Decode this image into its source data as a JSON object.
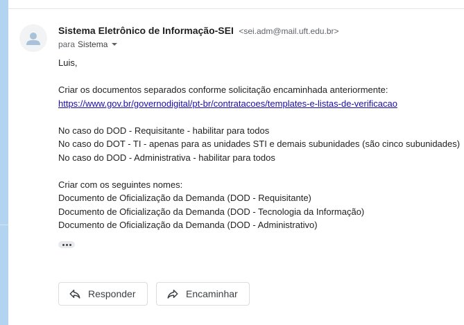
{
  "email": {
    "sender_name": "Sistema Eletrônico de Informação-SEI",
    "sender_email": "<sei.adm@mail.uft.edu.br>",
    "to_prefix": "para",
    "to_recipient": "Sistema",
    "body": {
      "greeting": "Luis,",
      "line1": "Criar os documentos separados conforme solicitação encaminhada anteriormente:",
      "link": "https://www.gov.br/governodigital/pt-br/contratacoes/templates-e-listas-de-verificacao",
      "case1": "No caso do DOD - Requisitante - habilitar para todos",
      "case2": "No caso do DOT - TI - apenas para as unidades STI e demais subunidades (são cinco subunidades)",
      "case3": "No caso do DOD - Administrativa - habilitar para todos",
      "names_intro": "Criar com os seguintes nomes:",
      "name1": "Documento de Oficialização da Demanda (DOD - Requisitante)",
      "name2": "Documento de Oficialização da Demanda (DOD - Tecnologia da Informação)",
      "name3": "Documento de Oficialização da Demanda (DOD - Administrativo)"
    }
  },
  "actions": {
    "reply_label": "Responder",
    "forward_label": "Encaminhar"
  },
  "icons": {
    "avatar": "person-icon",
    "caret": "chevron-down-icon",
    "reply": "reply-icon",
    "forward": "forward-icon",
    "more": "more-horizontal-icon"
  },
  "colors": {
    "sidebar": "#b3d4f0",
    "link": "#1a0dab",
    "button_border": "#dadce0"
  }
}
